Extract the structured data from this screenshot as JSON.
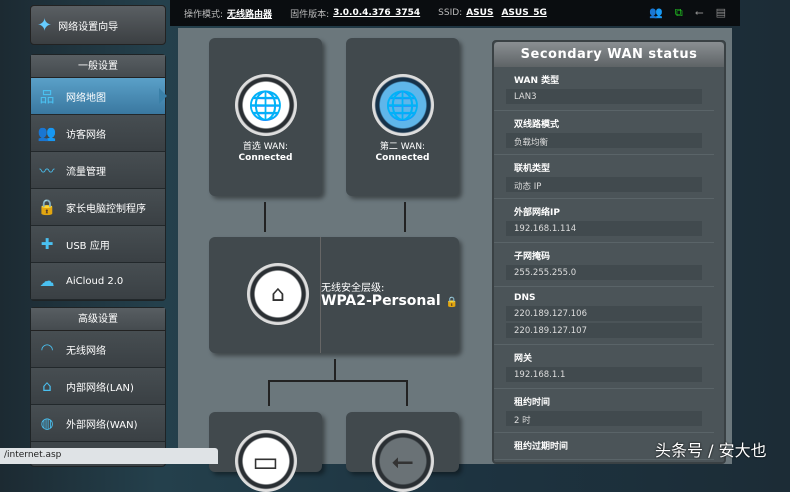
{
  "topbar": {
    "mode_label": "操作模式:",
    "mode_value": "无线路由器",
    "fw_label": "固件版本:",
    "fw_value": "3.0.0.4.376_3754",
    "ssid_label": "SSID:",
    "ssid1": "ASUS",
    "ssid2": "ASUS_5G"
  },
  "sidebar": {
    "wizard": "网络设置向导",
    "general_header": "一般设置",
    "general": [
      {
        "label": "网络地图",
        "icon": "network-map-icon"
      },
      {
        "label": "访客网络",
        "icon": "guest-icon"
      },
      {
        "label": "流量管理",
        "icon": "traffic-icon"
      },
      {
        "label": "家长电脑控制程序",
        "icon": "lock-icon"
      },
      {
        "label": "USB 应用",
        "icon": "puzzle-icon"
      },
      {
        "label": "AiCloud 2.0",
        "icon": "cloud-icon"
      }
    ],
    "advanced_header": "高级设置",
    "advanced": [
      {
        "label": "无线网络",
        "icon": "wifi-icon"
      },
      {
        "label": "内部网络(LAN)",
        "icon": "home-icon"
      },
      {
        "label": "外部网络(WAN)",
        "icon": "globe-icon"
      }
    ]
  },
  "map": {
    "wan1_label": "首选 WAN:",
    "wan1_status": "Connected",
    "wan2_label": "第二 WAN:",
    "wan2_status": "Connected",
    "security_label": "无线安全层级:",
    "security_value": "WPA2-Personal"
  },
  "status": {
    "title": "Secondary WAN status",
    "rows": [
      {
        "k": "WAN 类型",
        "v": [
          "LAN3"
        ]
      },
      {
        "k": "双线路模式",
        "v": [
          "负载均衡"
        ]
      },
      {
        "k": "联机类型",
        "v": [
          "动态 IP"
        ]
      },
      {
        "k": "外部网络IP",
        "v": [
          "192.168.1.114"
        ]
      },
      {
        "k": "子网掩码",
        "v": [
          "255.255.255.0"
        ]
      },
      {
        "k": "DNS",
        "v": [
          "220.189.127.106",
          "220.189.127.107"
        ]
      },
      {
        "k": "网关",
        "v": [
          "192.168.1.1"
        ]
      },
      {
        "k": "租约时间",
        "v": [
          "2 时"
        ]
      },
      {
        "k": "租约过期时间",
        "v": []
      }
    ]
  },
  "statusbar": "/internet.asp",
  "watermark": "头条号 / 安大也"
}
